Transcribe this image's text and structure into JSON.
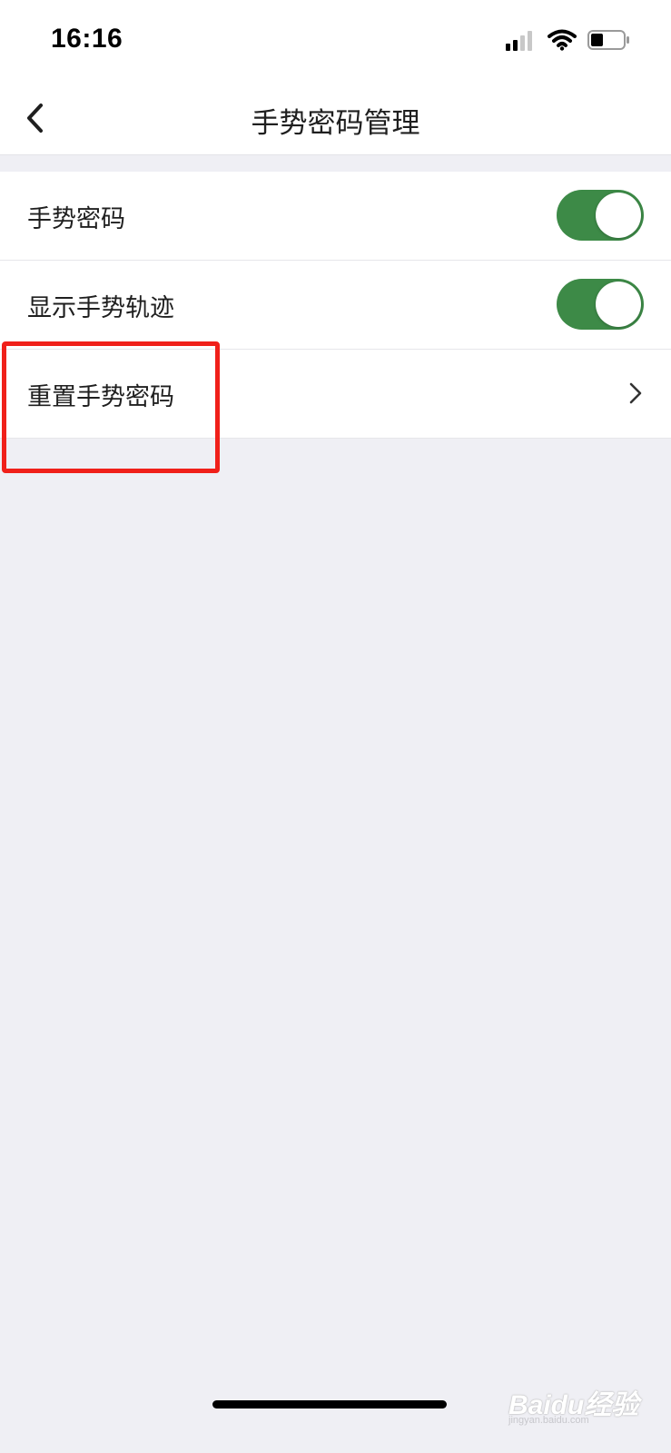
{
  "status_bar": {
    "time": "16:16"
  },
  "nav": {
    "title": "手势密码管理",
    "back_icon": "chevron-left-icon"
  },
  "settings": {
    "items": [
      {
        "label": "手势密码",
        "control": "toggle",
        "state": "on"
      },
      {
        "label": "显示手势轨迹",
        "control": "toggle",
        "state": "on"
      },
      {
        "label": "重置手势密码",
        "control": "disclosure",
        "icon": "chevron-right-icon"
      }
    ]
  },
  "annotation": {
    "highlighted_item": "重置手势密码",
    "color": "#f0201a"
  },
  "watermark": {
    "logo": "Baidu经验",
    "url": "jingyan.baidu.com"
  },
  "colors": {
    "toggle_on": "#3d8a47",
    "page_background": "#efeff4",
    "row_background": "#ffffff"
  }
}
